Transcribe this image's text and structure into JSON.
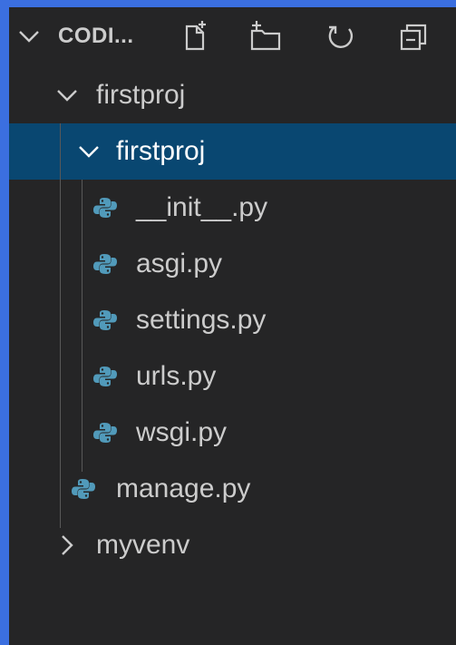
{
  "explorer": {
    "section_title": "CODI..."
  },
  "toolbar": {
    "new_file": "new-file-icon",
    "new_folder": "new-folder-icon",
    "refresh": "refresh-icon",
    "collapse": "collapse-all-icon"
  },
  "tree": {
    "root_folder": "firstproj",
    "sub_folder": "firstproj",
    "files": [
      "__init__.py",
      "asgi.py",
      "settings.py",
      "urls.py",
      "wsgi.py"
    ],
    "manage_file": "manage.py",
    "venv_folder": "myvenv"
  },
  "colors": {
    "background": "#252526",
    "selection": "#094771",
    "border": "#3b6fe0",
    "python_icon": "#519aba"
  }
}
